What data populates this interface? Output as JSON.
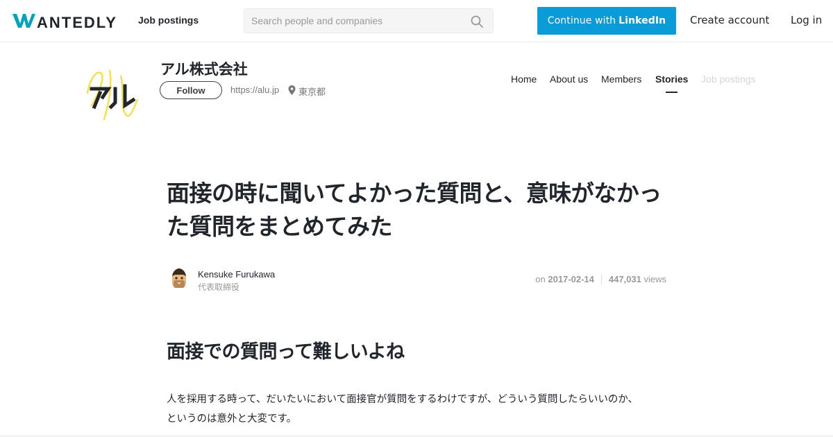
{
  "header": {
    "logo_text": "WANTEDLY",
    "job_postings": "Job postings",
    "search_placeholder": "Search people and companies",
    "linkedin_prefix": "Continue with",
    "linkedin_brand": "LinkedIn",
    "create_account": "Create account",
    "login": "Log in"
  },
  "company": {
    "name": "アル株式会社",
    "follow": "Follow",
    "url": "https://alu.jp",
    "location": "東京都",
    "tabs": [
      {
        "label": "Home",
        "state": "normal"
      },
      {
        "label": "About us",
        "state": "normal"
      },
      {
        "label": "Members",
        "state": "normal"
      },
      {
        "label": "Stories",
        "state": "active"
      },
      {
        "label": "Job postings",
        "state": "disabled"
      }
    ]
  },
  "article": {
    "title": "面接の時に聞いてよかった質問と、意味がなかった質問をまとめてみた",
    "author_name": "Kensuke Furukawa",
    "author_role": "代表取締役",
    "date_prefix": "on",
    "date": "2017-02-14",
    "views_count": "447,031",
    "views_label": "views",
    "section_heading": "面接での質問って難しいよね",
    "body_line1": "人を採用する時って、だいたいにおいて面接官が質問をするわけですが、どういう質問したらいいのか、",
    "body_line2": "というのは意外と大変です。"
  },
  "colors": {
    "brand": "#00a4bb",
    "linkedin": "#0a9bd9",
    "text": "#21252c",
    "logo_yellow": "#f5e04a"
  }
}
